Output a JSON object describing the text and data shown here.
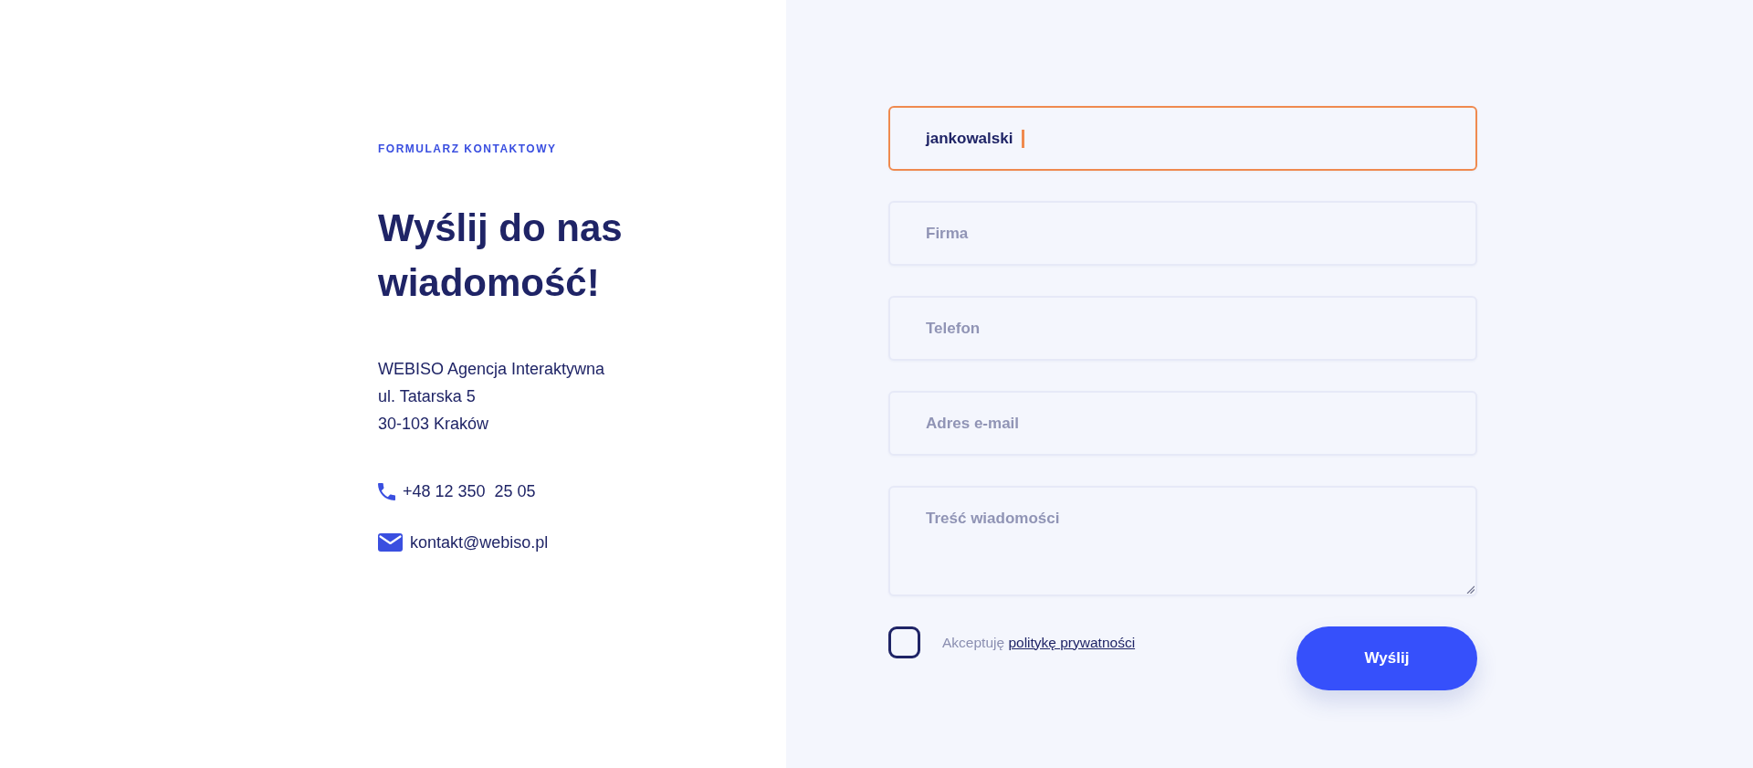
{
  "info": {
    "eyebrow": "FORMULARZ KONTAKTOWY",
    "heading": "Wyślij do nas wiadomość!",
    "address_lines": [
      "WEBISO Agencja Interaktywna",
      "ul. Tatarska 5",
      "30-103 Kraków"
    ],
    "contacts": [
      {
        "kind": "phone",
        "text": "+48 12 350  25 05"
      },
      {
        "kind": "email",
        "text": "kontakt@webiso.pl"
      }
    ]
  },
  "form": {
    "fields": [
      {
        "kind": "input",
        "value": "jankowalski",
        "focused": true
      },
      {
        "kind": "input",
        "placeholder": "Firma",
        "focused": false
      },
      {
        "kind": "input",
        "placeholder": "Telefon",
        "focused": false
      },
      {
        "kind": "input",
        "placeholder": "Adres e-mail",
        "focused": false
      },
      {
        "kind": "textarea",
        "placeholder": "Treść wiadomości",
        "focused": false
      }
    ],
    "consent": {
      "text": "Akceptuję",
      "link": "politykę prywatności",
      "checked": false
    },
    "submit_button": "Wyślij"
  }
}
